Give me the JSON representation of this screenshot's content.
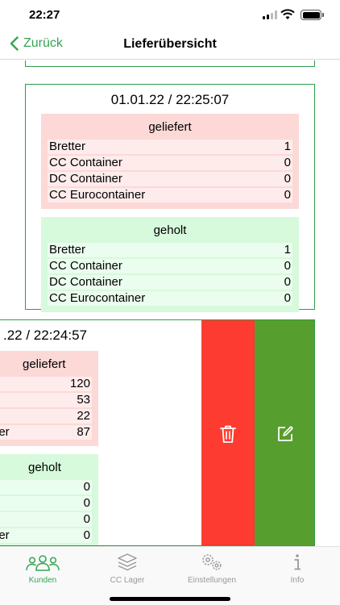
{
  "status_bar": {
    "time": "22:27"
  },
  "nav": {
    "back_label": "Zurück",
    "title": "Lieferübersicht"
  },
  "entries": [
    {
      "date": "01.01.22 / 22:25:07",
      "delivered": {
        "title": "geliefert",
        "rows": [
          {
            "label": "Bretter",
            "value": "1"
          },
          {
            "label": "CC Container",
            "value": "0"
          },
          {
            "label": "DC Container",
            "value": "0"
          },
          {
            "label": "CC Eurocontainer",
            "value": "0"
          }
        ]
      },
      "collected": {
        "title": "geholt",
        "rows": [
          {
            "label": "Bretter",
            "value": "1"
          },
          {
            "label": "CC Container",
            "value": "0"
          },
          {
            "label": "DC Container",
            "value": "0"
          },
          {
            "label": "CC Eurocontainer",
            "value": "0"
          }
        ]
      }
    },
    {
      "date": ".22 / 22:24:57",
      "delivered": {
        "title": "geliefert",
        "rows": [
          {
            "label": "",
            "value": "120"
          },
          {
            "label": "",
            "value": "53"
          },
          {
            "label": "",
            "value": "22"
          },
          {
            "label": "ner",
            "value": "87"
          }
        ]
      },
      "collected": {
        "title": "geholt",
        "rows": [
          {
            "label": "",
            "value": "0"
          },
          {
            "label": "",
            "value": "0"
          },
          {
            "label": "",
            "value": "0"
          },
          {
            "label": "ner",
            "value": "0"
          }
        ]
      }
    }
  ],
  "swipe_actions": {
    "delete_icon": "trash-icon",
    "edit_icon": "edit-icon"
  },
  "tabs": [
    {
      "label": "Kunden",
      "icon": "people-icon",
      "active": true
    },
    {
      "label": "CC Lager",
      "icon": "layers-icon",
      "active": false
    },
    {
      "label": "Einstellungen",
      "icon": "gears-icon",
      "active": false
    },
    {
      "label": "Info",
      "icon": "info-icon",
      "active": false
    }
  ],
  "colors": {
    "accent": "#34a553",
    "card_border": "#2f9e4a",
    "delivered_bg": "#fcd9d6",
    "collected_bg": "#d6fadb",
    "delete": "#fe3b30",
    "edit": "#569e2d"
  }
}
